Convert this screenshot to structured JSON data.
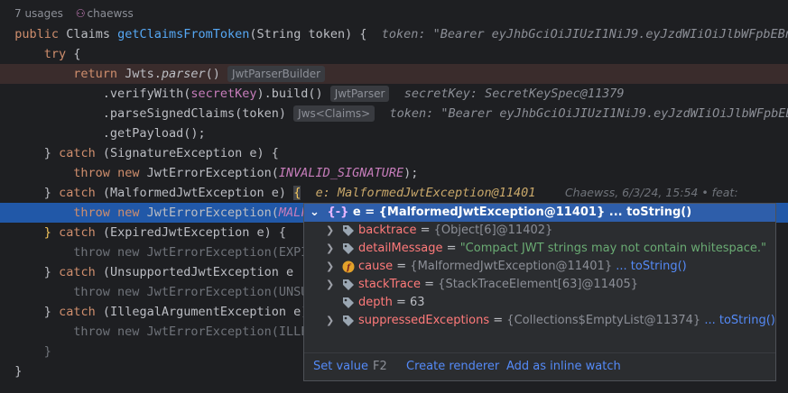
{
  "header": {
    "usages": "7 usages",
    "author": "chaewss"
  },
  "code": {
    "l1_kw": "public",
    "l1_type": "Claims",
    "l1_fn": "getClaimsFromToken",
    "l1_params": "(String token) {",
    "l1_hint": "token: \"Bearer eyJhbGciOiJIUzI1NiJ9.eyJzdWIiOiJlbWFpbEBnb",
    "l2_kw": "try",
    "l2_rest": "{",
    "l3_kw": "return",
    "l3_obj": "Jwts.",
    "l3_method": "parser",
    "l3_rest": "()",
    "l3_inlay": "JwtParserBuilder",
    "l4_a": ".verifyWith(",
    "l4_field": "secretKey",
    "l4_b": ").build()",
    "l4_inlay": "JwtParser",
    "l4_hint": "secretKey: SecretKeySpec@11379",
    "l5_a": ".parseSignedClaims(token)",
    "l5_inlay": "Jws<Claims>",
    "l5_hint": "token: \"Bearer eyJhbGciOiJIUzI1NiJ9.eyJzdWIiOiJlbWFpbEBnb",
    "l6": ".getPayload();",
    "l7_a": "}",
    "l7_kw": "catch",
    "l7_b": "(SignatureException e) {",
    "l8_kw1": "throw",
    "l8_kw2": "new",
    "l8_a": "JwtErrorException(",
    "l8_const": "INVALID_SIGNATURE",
    "l8_b": ");",
    "l9_a": "}",
    "l9_kw": "catch",
    "l9_b": "(MalformedJwtException e)",
    "l9_brace": "{",
    "l9_hint": "e: MalformedJwtException@11401",
    "l9_blame": "Chaewss, 6/3/24, 15:54 • feat: ",
    "l10_kw1": "throw",
    "l10_kw2": "new",
    "l10_a": "JwtErrorException(",
    "l10_const": "MALF",
    "l11_brace": "}",
    "l11_kw": "catch",
    "l11_b": "(ExpiredJwtException e) {",
    "l12": "throw new JwtErrorException(EXPI",
    "l13_a": "}",
    "l13_kw": "catch",
    "l13_b": "(UnsupportedJwtException e",
    "l14": "throw new JwtErrorException(UNSU",
    "l15_a": "}",
    "l15_kw": "catch",
    "l15_b": "(IllegalArgumentException e)",
    "l16": "throw new JwtErrorException(ILLE",
    "l17": "}",
    "l18": "}"
  },
  "popup": {
    "header_var": "e = ",
    "header_obj": "{MalformedJwtException@11401}",
    "header_link": " ... toString()",
    "rows": [
      {
        "name": "backtrace",
        "eq": " = ",
        "value": "{Object[6]@11402}",
        "link": ""
      },
      {
        "name": "detailMessage",
        "eq": " = ",
        "value": "\"Compact JWT strings may not contain whitespace.\"",
        "link": ""
      },
      {
        "name": "cause",
        "eq": " = ",
        "value": "{MalformedJwtException@11401}",
        "link": "... toString()"
      },
      {
        "name": "stackTrace",
        "eq": " = ",
        "value": "{StackTraceElement[63]@11405}",
        "link": ""
      },
      {
        "name": "depth",
        "eq": " = ",
        "value": "63",
        "link": ""
      },
      {
        "name": "suppressedExceptions",
        "eq": " = ",
        "value": "{Collections$EmptyList@11374}",
        "link": "... toString()"
      }
    ],
    "footer": {
      "set_value": "Set value",
      "shortcut": "F2",
      "create_renderer": "Create renderer",
      "inline_watch": "Add as inline watch"
    }
  },
  "colors": {
    "accent": "#2158a8",
    "link": "#548af7",
    "field": "#ff7a7a",
    "string": "#6aab73"
  }
}
